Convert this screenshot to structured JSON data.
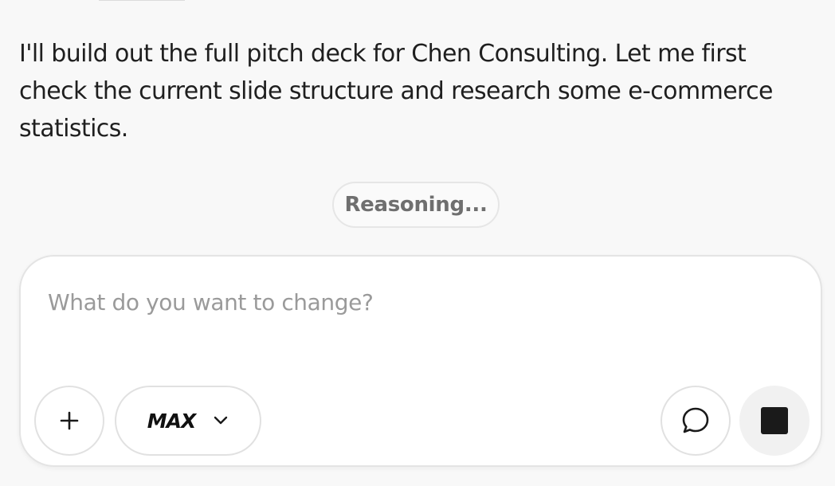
{
  "message": {
    "text": "I'll build out the full pitch deck for Chen Consulting. Let me first check the current slide structure and research some e-commerce statistics."
  },
  "status": {
    "label": "Reasoning..."
  },
  "composer": {
    "placeholder": "What do you want to change?",
    "value": "",
    "model_label": "MAX",
    "add_icon": "plus-icon",
    "model_icon": "chevron-down-icon",
    "chat_icon": "speech-bubble-icon",
    "stop_icon": "stop-icon"
  }
}
